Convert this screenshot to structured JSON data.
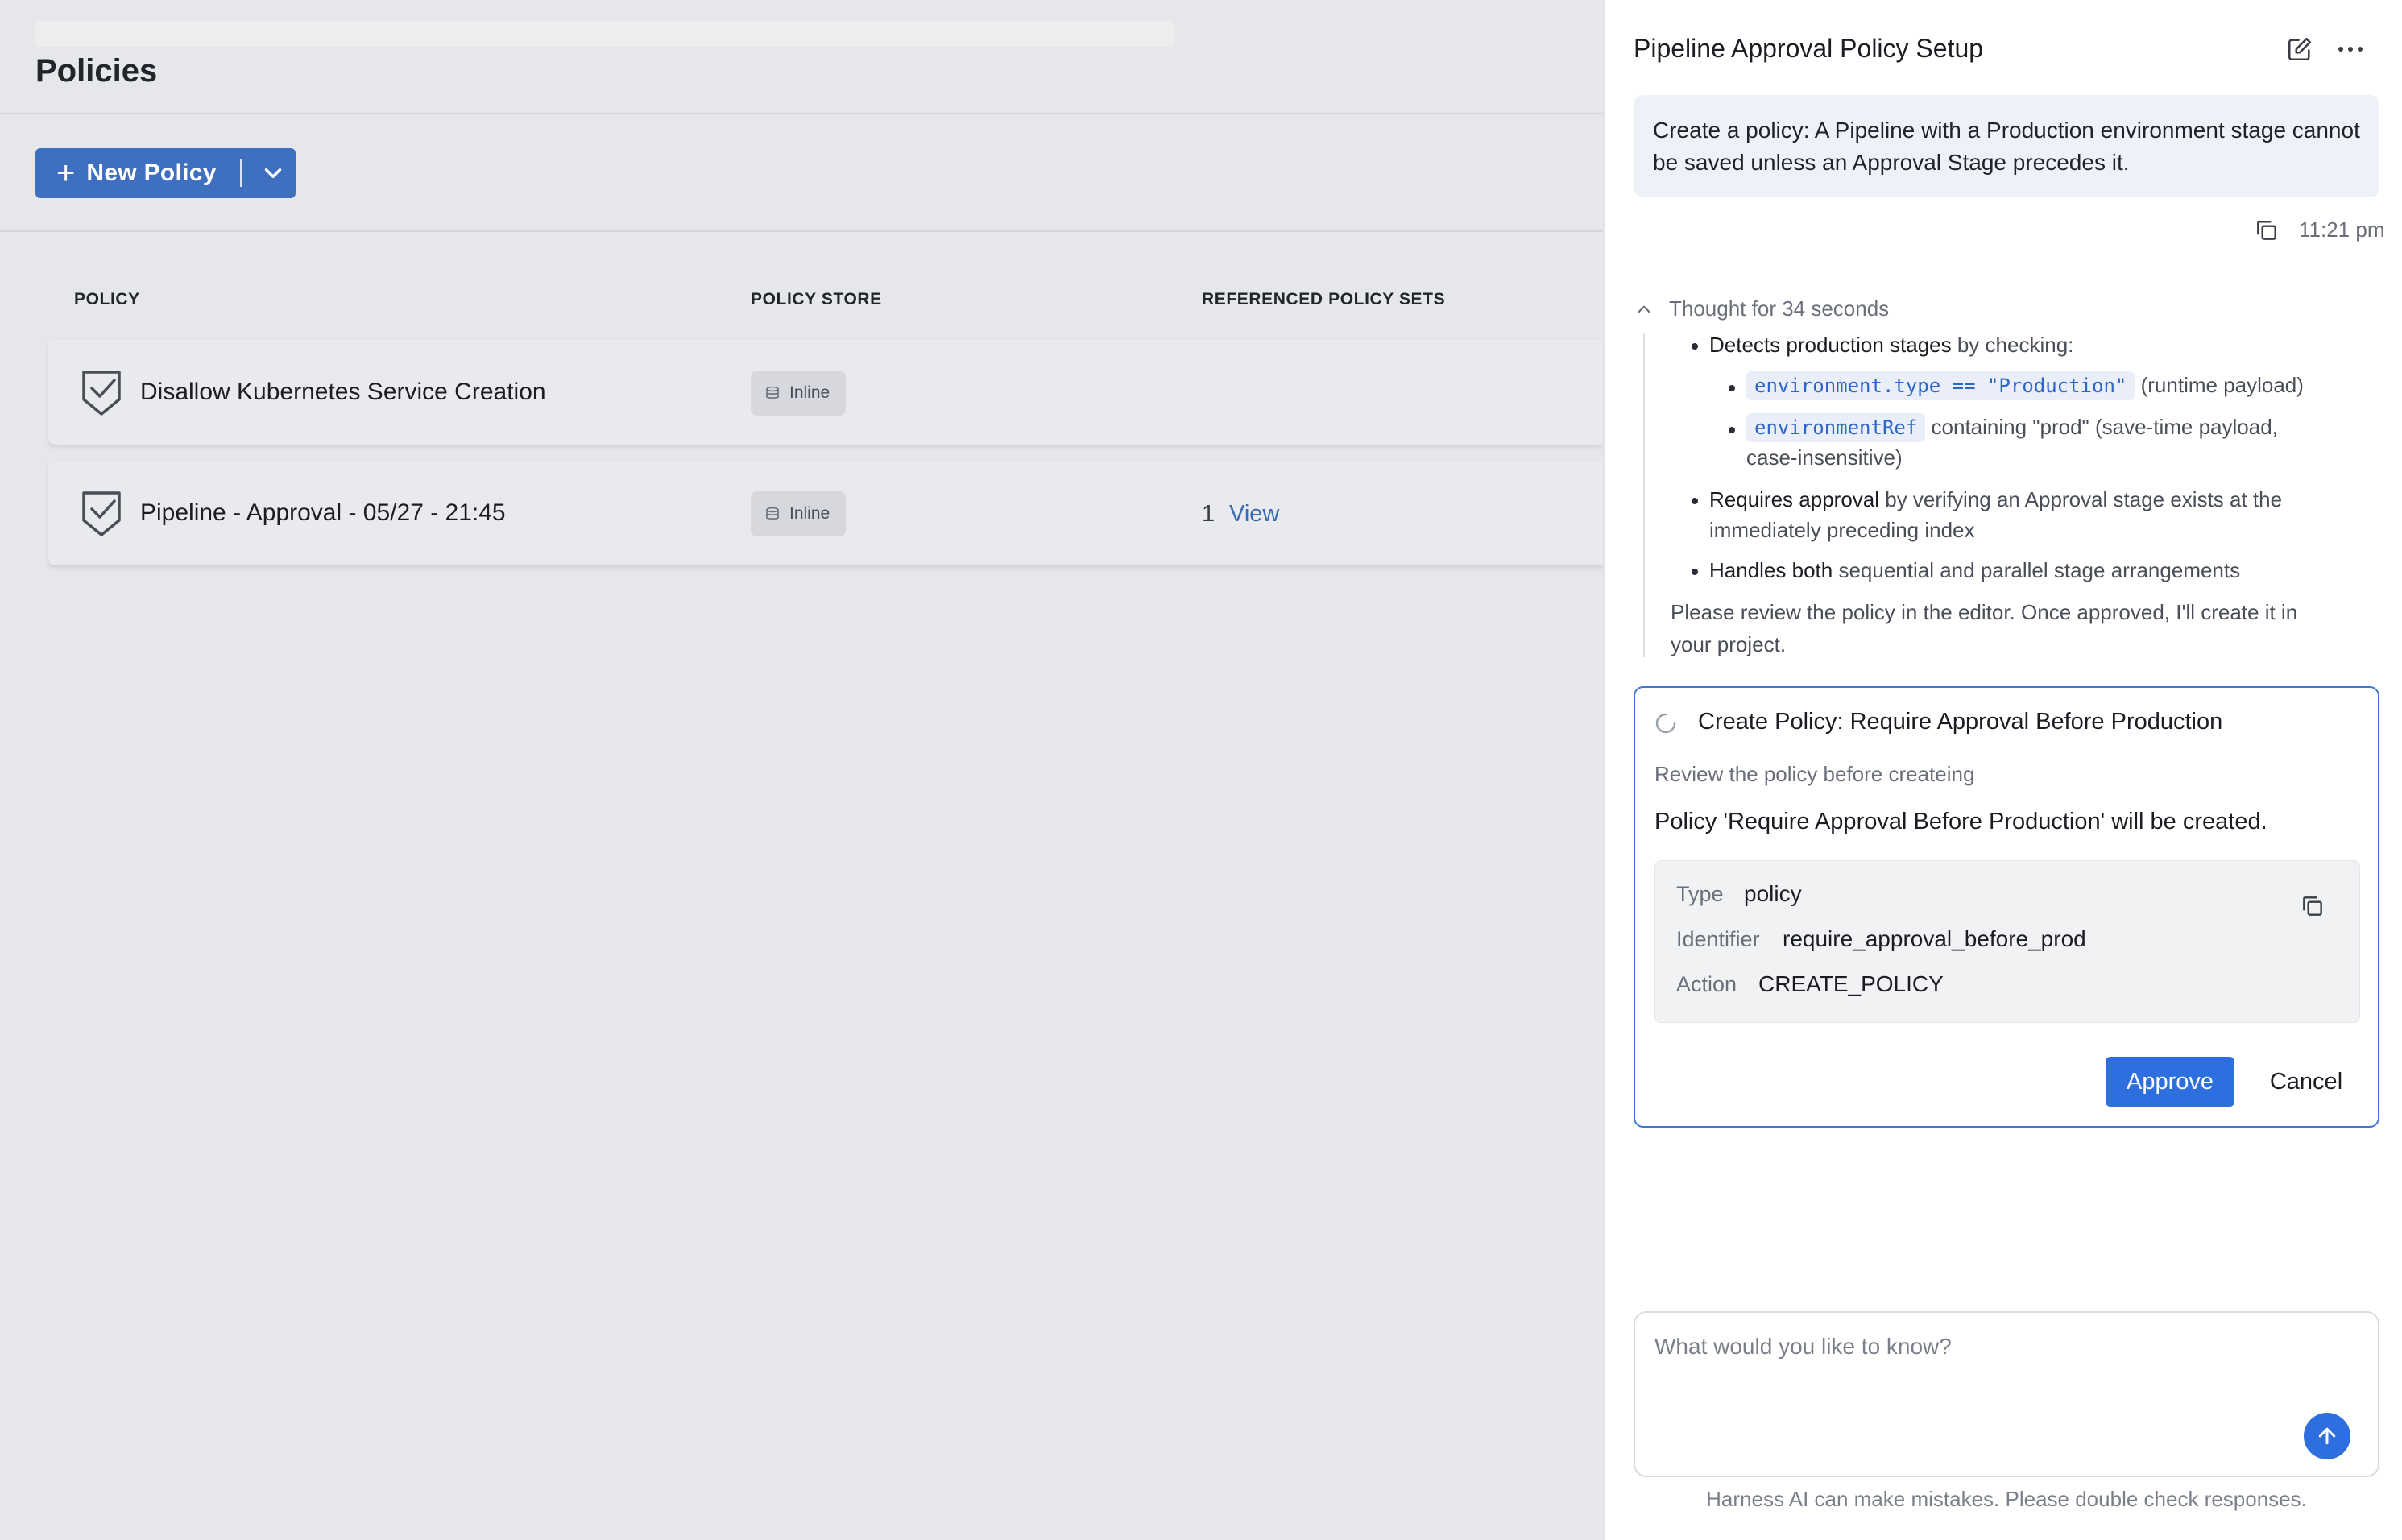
{
  "page": {
    "title": "Policies",
    "new_policy_label": "New Policy"
  },
  "table": {
    "headers": {
      "policy": "POLICY",
      "store": "POLICY STORE",
      "sets": "REFERENCED POLICY SETS"
    },
    "rows": [
      {
        "name": "Disallow Kubernetes Service Creation",
        "store": "Inline",
        "ref_count": "",
        "view": ""
      },
      {
        "name": "Pipeline - Approval - 05/27 - 21:45",
        "store": "Inline",
        "ref_count": "1",
        "view": "View"
      }
    ]
  },
  "panel": {
    "title": "Pipeline Approval Policy Setup",
    "user_message": "Create a policy: A Pipeline with a Production environment stage cannot be saved unless an Approval Stage precedes it.",
    "time": "11:21 pm",
    "thought_label": "Thought for 34 seconds",
    "thought": {
      "detects_bold": "Detects production stages",
      "detects_rest": " by checking:",
      "code1": "environment.type == \"Production\"",
      "code1_rest": "(runtime payload)",
      "code2": "environmentRef",
      "code2_rest": "containing \"prod\" (save-time payload,",
      "code2_rest2": "case-insensitive)",
      "requires_bold": "Requires approval",
      "requires_rest": " by verifying an Approval stage exists at the",
      "requires_rest2": "immediately preceding index",
      "handles_bold": "Handles both",
      "handles_rest": " sequential and parallel stage arrangements",
      "review1": "Please review the policy in the editor. Once approved, I'll create it in",
      "review2": "your project."
    },
    "card": {
      "title": "Create Policy: Require Approval Before Production",
      "subtitle": "Review the policy before createing",
      "description": "Policy 'Require Approval Before Production' will be created.",
      "type_key": "Type",
      "type_val": "policy",
      "id_key": "Identifier",
      "id_val": "require_approval_before_prod",
      "action_key": "Action",
      "action_val": "CREATE_POLICY",
      "approve": "Approve",
      "cancel": "Cancel"
    },
    "input_placeholder": "What would you like to know?",
    "disclaimer": "Harness AI can make mistakes. Please double check responses."
  },
  "colors": {
    "primary": "#3f6fbf",
    "accent": "#2d6fde",
    "link": "#3a68b8"
  }
}
